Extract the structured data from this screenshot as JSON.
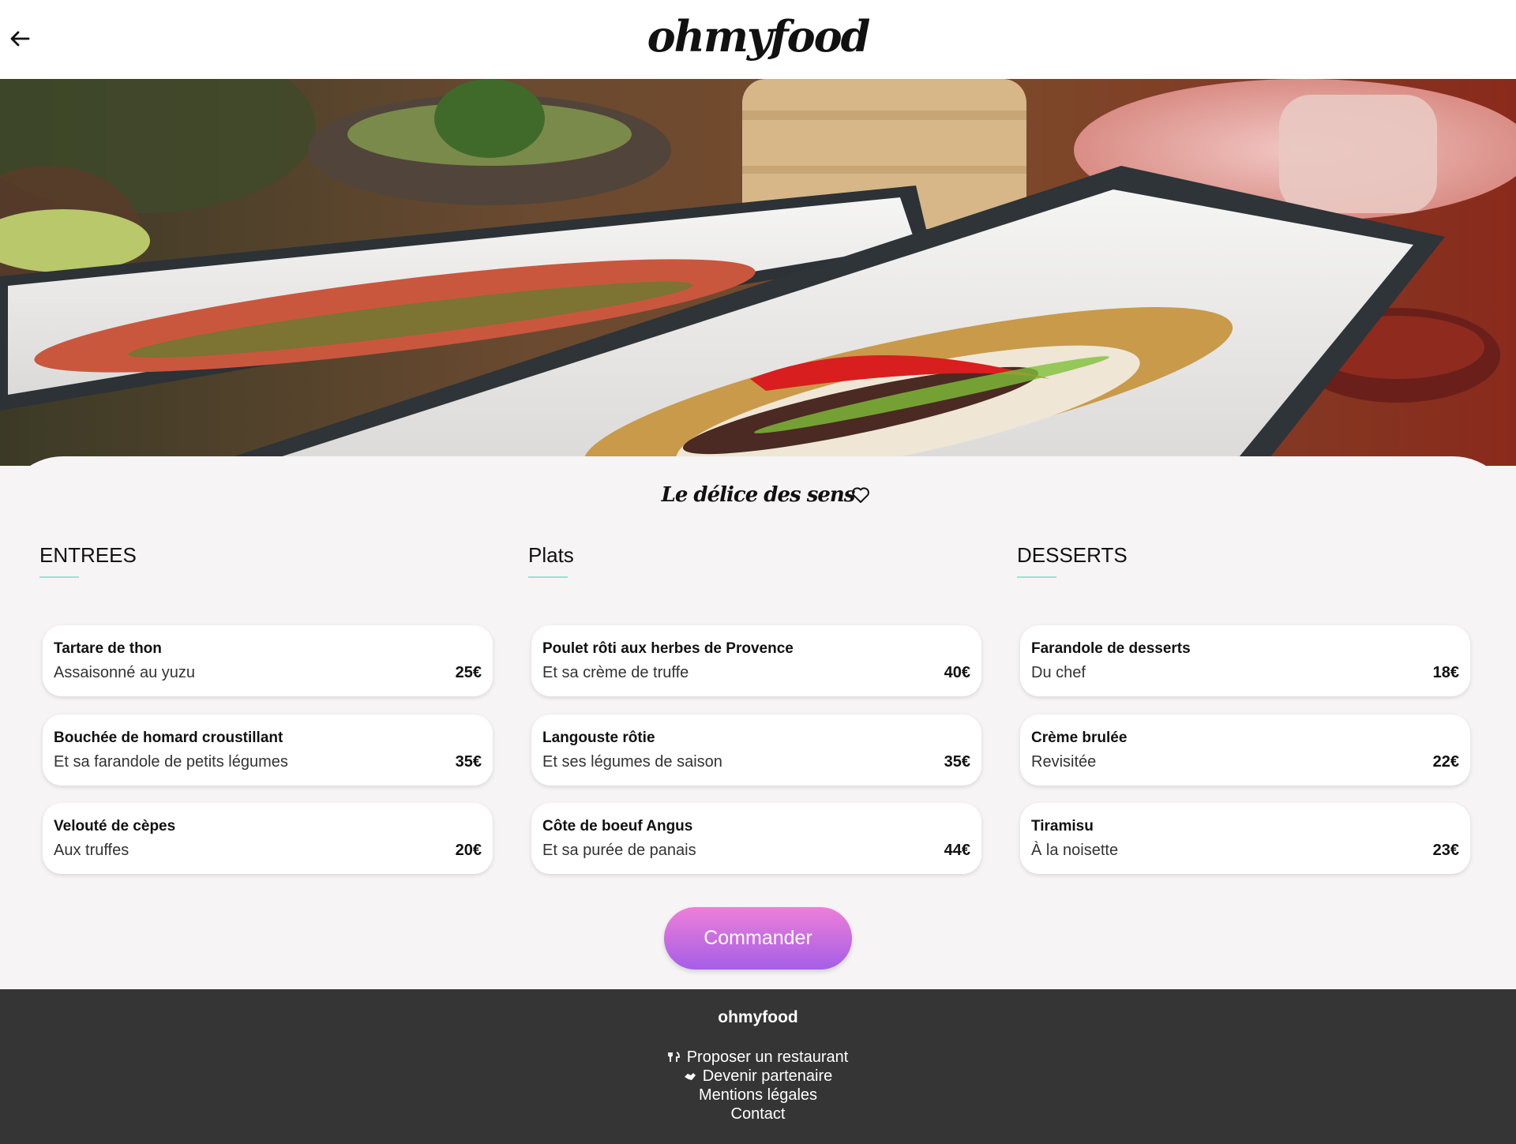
{
  "header": {
    "logo": "ohmyfood",
    "back_icon": "arrow-left-icon"
  },
  "restaurant": {
    "name": "Le délice des sens",
    "favorite_icon": "heart-outline-icon"
  },
  "menu": {
    "sections": [
      {
        "title": "ENTREES",
        "items": [
          {
            "name": "Tartare de thon",
            "desc": "Assaisonné au yuzu",
            "price": "25€"
          },
          {
            "name": "Bouchée de homard croustillant",
            "desc": "Et sa farandole de petits légumes",
            "price": "35€"
          },
          {
            "name": "Velouté de cèpes",
            "desc": "Aux truffes",
            "price": "20€"
          }
        ]
      },
      {
        "title": "Plats",
        "items": [
          {
            "name": "Poulet rôti aux herbes de Provence",
            "desc": "Et sa crème de truffe",
            "price": "40€"
          },
          {
            "name": "Langouste rôtie",
            "desc": "Et ses légumes de saison",
            "price": "35€"
          },
          {
            "name": "Côte de boeuf Angus",
            "desc": "Et sa purée de panais",
            "price": "44€"
          }
        ]
      },
      {
        "title": "DESSERTS",
        "items": [
          {
            "name": "Farandole de desserts",
            "desc": "Du chef",
            "price": "18€"
          },
          {
            "name": "Crème brulée",
            "desc": "Revisitée",
            "price": "22€"
          },
          {
            "name": "Tiramisu",
            "desc": "À la noisette",
            "price": "23€"
          }
        ]
      }
    ],
    "underline_color": "#99e2d0"
  },
  "order_button": {
    "label": "Commander",
    "gradient": [
      "#ee7fd9",
      "#a55ee6"
    ]
  },
  "footer": {
    "brand": "ohmyfood",
    "links": [
      {
        "label": "Proposer un restaurant",
        "icon": "utensils-icon"
      },
      {
        "label": "Devenir partenaire",
        "icon": "handshake-icon"
      },
      {
        "label": "Mentions légales"
      },
      {
        "label": "Contact"
      }
    ],
    "background": "#353535"
  }
}
